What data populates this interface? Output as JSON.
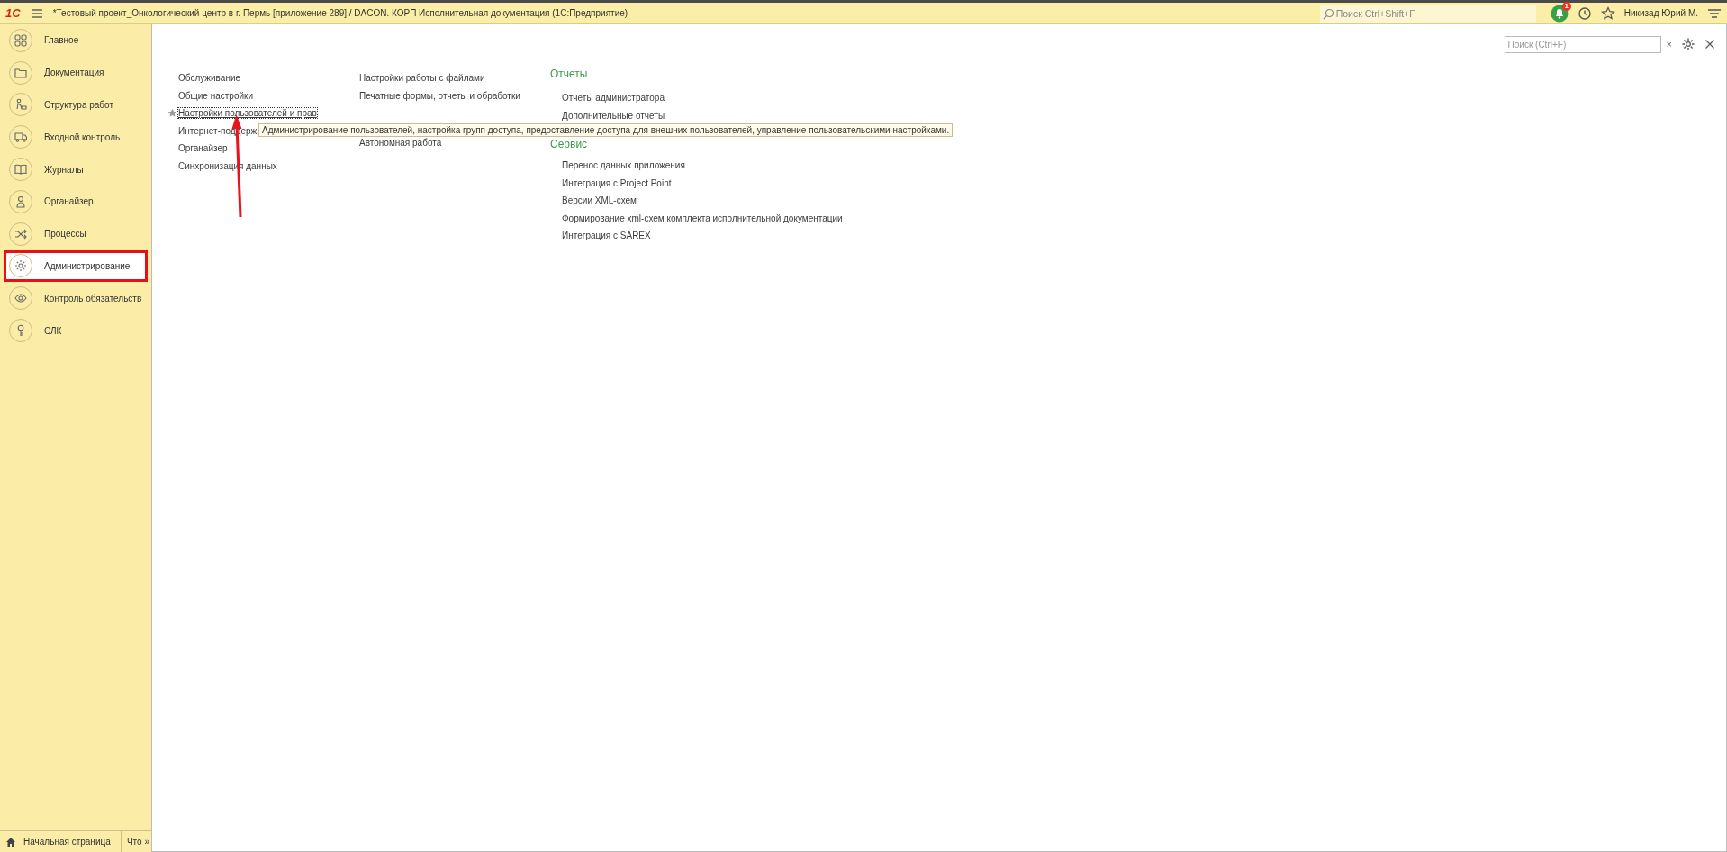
{
  "window": {
    "title": "*Тестовый проект_Онкологический центр в г. Пермь [приложение 289] / DACON. КОРП Исполнительная документация  (1С:Предприятие)"
  },
  "top_bar": {
    "logo": "1С",
    "search": {
      "placeholder": "Поиск Ctrl+Shift+F"
    },
    "notifications_badge": "1",
    "user": "Никизад Юрий М."
  },
  "sidebar": {
    "items": [
      {
        "label": "Главное",
        "selected": false
      },
      {
        "label": "Документация",
        "selected": false
      },
      {
        "label": "Структура работ",
        "selected": false
      },
      {
        "label": "Входной контроль",
        "selected": false
      },
      {
        "label": "Журналы",
        "selected": false
      },
      {
        "label": "Органайзер",
        "selected": false
      },
      {
        "label": "Процессы",
        "selected": false
      },
      {
        "label": "Администрирование",
        "selected": true
      },
      {
        "label": "Контроль обязательств",
        "selected": false
      },
      {
        "label": "СЛК",
        "selected": false
      }
    ]
  },
  "panel": {
    "search": {
      "placeholder": "Поиск (Ctrl+F)",
      "clear": "×"
    },
    "column_1": [
      {
        "label": "Обслуживание",
        "selected": false
      },
      {
        "label": "Общие настройки",
        "selected": false
      },
      {
        "label": "Настройки пользователей и прав",
        "selected": true
      },
      {
        "label": "Интернет-поддерж",
        "selected": false
      },
      {
        "label": "Органайзер",
        "selected": false
      },
      {
        "label": "Синхронизация данных",
        "selected": false
      }
    ],
    "column_2": [
      [
        "Настройки работы с файлами",
        "Печатные формы, отчеты и обработки"
      ],
      [
        "Автономная работа"
      ]
    ],
    "sections": [
      {
        "title": "Отчеты",
        "items": [
          "Отчеты администратора",
          "Дополнительные отчеты"
        ]
      },
      {
        "title": "Сервис",
        "items": [
          "Перенос данных приложения",
          "Интеграция с Project Point",
          "Версии XML-схем",
          "Формирование xml-схем комплекта исполнительной документации",
          "Интеграция с SAREX"
        ]
      }
    ],
    "tooltip": "Администрирование пользователей, настройка групп доступа, предоставление доступа для внешних пользователей, управление пользовательскими настройками."
  },
  "bottom_tabs": [
    {
      "label": "Начальная страница",
      "kind": "home"
    },
    {
      "label": "Что »",
      "kind": "plain"
    }
  ]
}
